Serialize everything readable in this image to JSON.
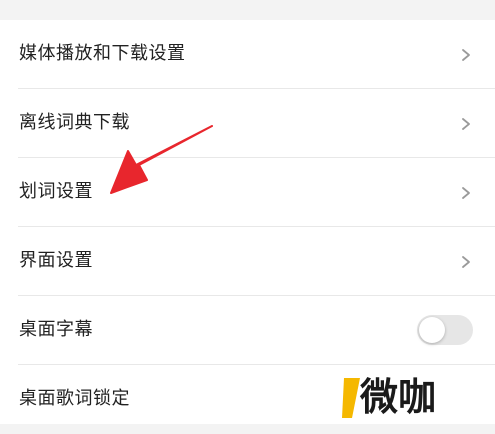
{
  "settings": {
    "items": [
      {
        "label": "媒体播放和下载设置",
        "control": "chevron"
      },
      {
        "label": "离线词典下载",
        "control": "chevron"
      },
      {
        "label": "划词设置",
        "control": "chevron"
      },
      {
        "label": "界面设置",
        "control": "chevron"
      },
      {
        "label": "桌面字幕",
        "control": "toggle",
        "toggle_on": false
      },
      {
        "label": "桌面歌词锁定",
        "control": "none"
      }
    ]
  },
  "annotation": {
    "arrow_color": "#e8262d",
    "points_to": "划词设置"
  },
  "watermark": {
    "text": "微咖",
    "accent_color": "#f5b800"
  },
  "colors": {
    "page_background": "#f3f3f3",
    "card_background": "#ffffff",
    "text": "#222222",
    "divider": "#e8e8e8",
    "chevron": "#9a9a9a",
    "toggle_off": "#e6e6e6"
  },
  "icons": {
    "row_chevron": "chevron-right-icon",
    "toggle": "toggle-switch"
  }
}
